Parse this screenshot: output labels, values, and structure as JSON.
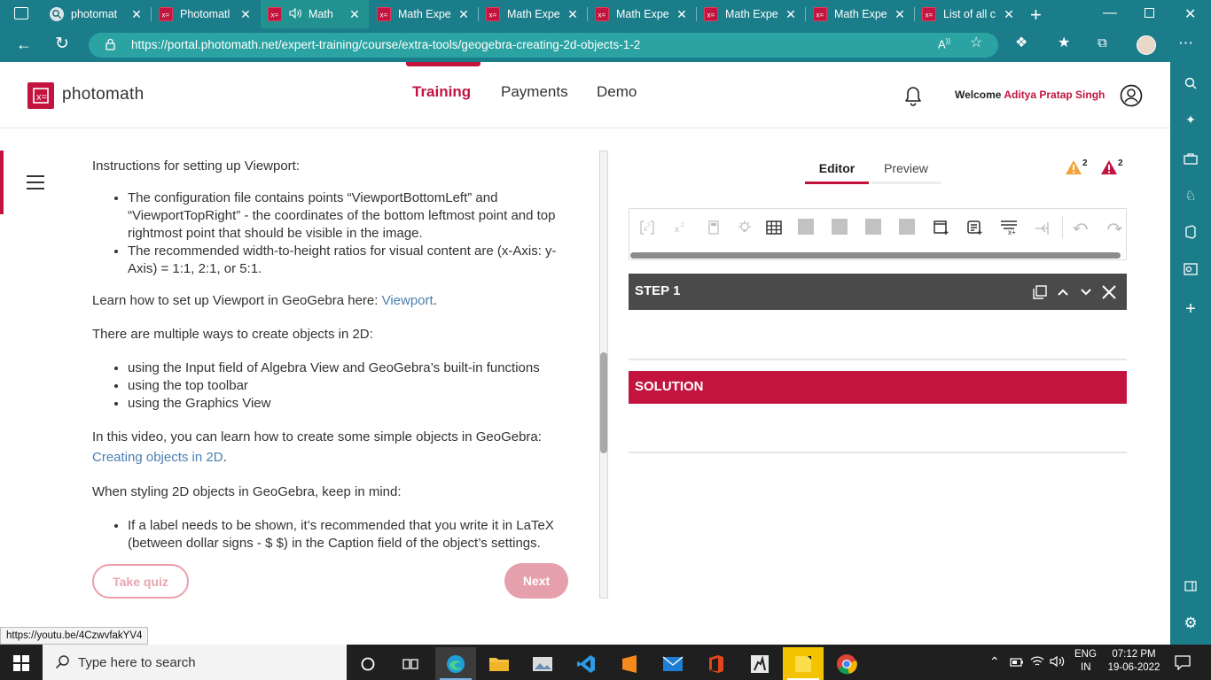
{
  "browser": {
    "tabs": [
      {
        "label": "photomat",
        "icon": "search-tab-icon"
      },
      {
        "label": "Photomatl",
        "icon": "photomath-tab-icon"
      },
      {
        "label": "Math",
        "icon": "photomath-tab-icon",
        "audio": true,
        "active": true
      },
      {
        "label": "Math Expe",
        "icon": "photomath-tab-icon"
      },
      {
        "label": "Math Expe",
        "icon": "photomath-tab-icon"
      },
      {
        "label": "Math Expe",
        "icon": "photomath-tab-icon"
      },
      {
        "label": "Math Expe",
        "icon": "photomath-tab-icon"
      },
      {
        "label": "Math Expe",
        "icon": "photomath-tab-icon"
      },
      {
        "label": "List of all c",
        "icon": "photomath-tab-icon"
      }
    ],
    "url": "https://portal.photomath.net/expert-training/course/extra-tools/geogebra-creating-2d-objects-1-2",
    "status_url": "https://youtu.be/4CzwvfakYV4"
  },
  "header": {
    "logo_text": "photomath",
    "nav": [
      {
        "label": "Training",
        "active": true
      },
      {
        "label": "Payments"
      },
      {
        "label": "Demo"
      }
    ],
    "welcome_prefix": "Welcome",
    "welcome_name": "Aditya Pratap Singh"
  },
  "content": {
    "p1": "Instructions for setting up Viewport:",
    "list1": [
      "The configuration file contains points “ViewportBottomLeft” and “ViewportTopRight” - the coordinates of the bottom leftmost point and top rightmost point that should be visible in the image.",
      "The recommended width-to-height ratios for visual content are (x-Axis: y-Axis) = 1:1, 2:1, or 5:1."
    ],
    "p2_text": "Learn how to set up Viewport in GeoGebra here: ",
    "p2_link": "Viewport",
    "p3": "There are multiple ways to create objects in 2D:",
    "list2": [
      "using the Input field of Algebra View and GeoGebra’s built-in functions",
      "using the top toolbar",
      "using the Graphics View"
    ],
    "p4_text": "In this video, you can learn how to create some simple objects in GeoGebra: ",
    "p4_link": "Creating objects in 2D",
    "p5": "When styling 2D objects in GeoGebra, keep in mind:",
    "list3": [
      "If a label needs to be shown, it’s recommended that you write it in LaTeX (between dollar signs - $ $) in the Caption field of the object’s settings."
    ],
    "take_quiz": "Take quiz",
    "next": "Next"
  },
  "editor": {
    "tab_editor": "Editor",
    "tab_preview": "Preview",
    "warning_count": "2",
    "error_count": "2",
    "step_title": "STEP 1",
    "solution_title": "SOLUTION"
  },
  "taskbar": {
    "search_placeholder": "Type here to search",
    "lang_top": "ENG",
    "lang_bottom": "IN",
    "time": "07:12 PM",
    "date": "19-06-2022"
  },
  "colors": {
    "brand": "#c2143f",
    "browser_chrome": "#1b7d8a",
    "link": "#4a7fb0"
  }
}
